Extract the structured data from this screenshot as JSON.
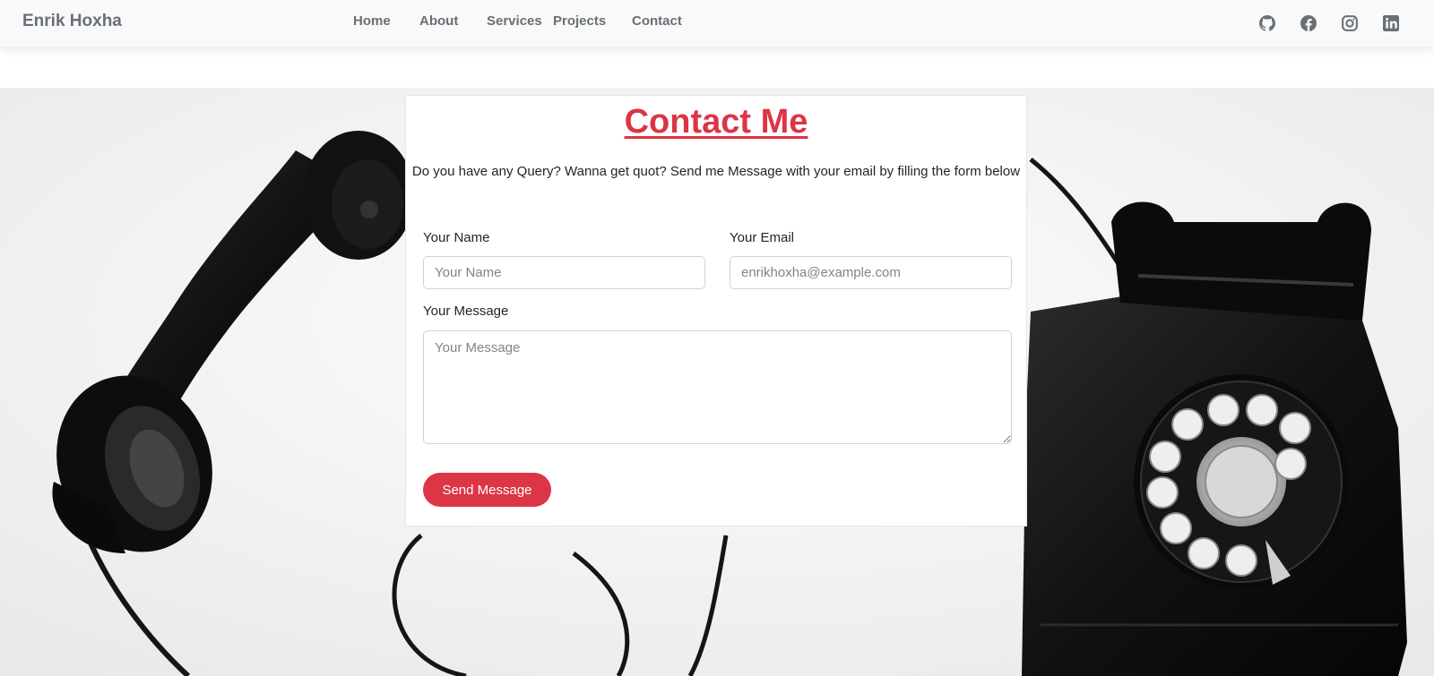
{
  "navbar": {
    "brand": "Enrik Hoxha",
    "links": [
      "Home",
      "About",
      "Services",
      "Projects",
      "Contact"
    ],
    "social_icons": [
      "github-icon",
      "facebook-icon",
      "instagram-icon",
      "linkedin-icon"
    ]
  },
  "contact": {
    "title": "Contact Me",
    "intro": "Do you have any Query? Wanna get quot? Send me Message with your email by filling the form below",
    "name_label": "Your Name",
    "name_placeholder": "Your Name",
    "email_label": "Your Email",
    "email_placeholder": "enrikhoxha@example.com",
    "message_label": "Your Message",
    "message_placeholder": "Your Message",
    "send_label": "Send Message"
  },
  "theme": {
    "accent": "#dc3545",
    "navbar_bg": "#f8f9fa",
    "nav_text": "#6c6f72"
  }
}
